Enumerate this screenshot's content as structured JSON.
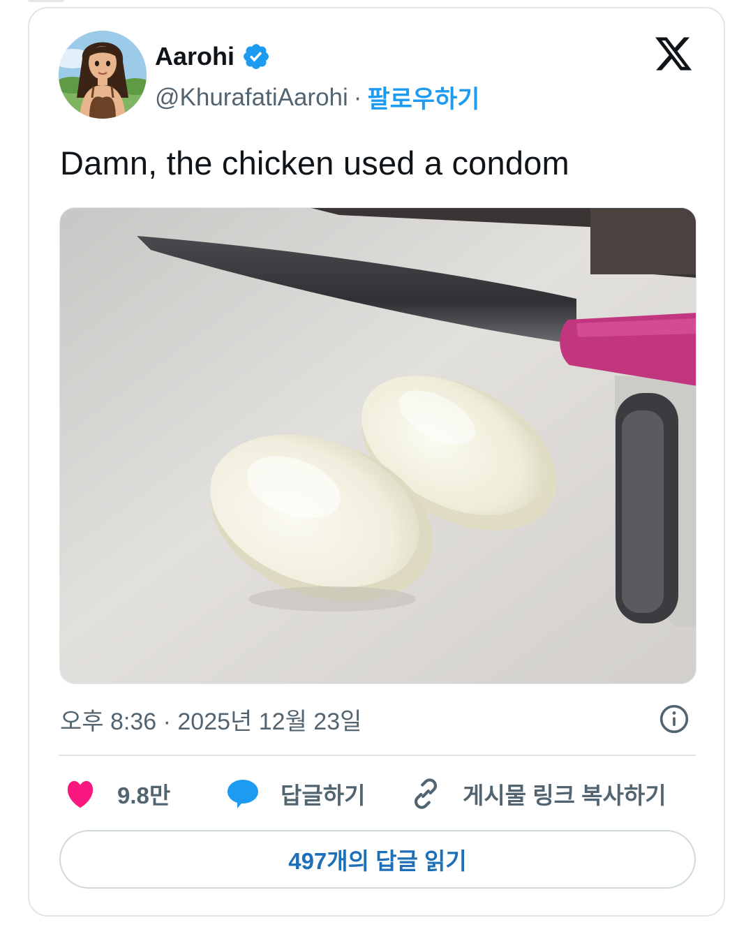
{
  "tweet": {
    "author": {
      "display_name": "Aarohi",
      "handle": "@KhurafatiAarohi",
      "separator": "·",
      "follow_label": "팔로우하기",
      "verified": true,
      "avatar_icon": "illustrated-woman-avatar"
    },
    "brand_icon": "x-logo-icon",
    "text": "Damn, the chicken used a condom",
    "media": {
      "description_icon": "photo-boiled-egg-halves-knife-cutting-board"
    },
    "timestamp": "오후 8:36 · 2025년 12월 23일",
    "info_icon": "info-icon",
    "actions": {
      "like": {
        "count": "9.8만",
        "icon": "heart-icon",
        "color": "#f91880"
      },
      "reply": {
        "label": "답글하기",
        "icon": "speech-bubble-icon",
        "color": "#1d9bf0"
      },
      "copy_link": {
        "label": "게시물 링크 복사하기",
        "icon": "link-icon"
      }
    },
    "read_replies_label": "497개의 답글 읽기"
  },
  "colors": {
    "accent": "#1d9bf0",
    "secondary_text": "#536471",
    "border": "#e1e4e8"
  }
}
